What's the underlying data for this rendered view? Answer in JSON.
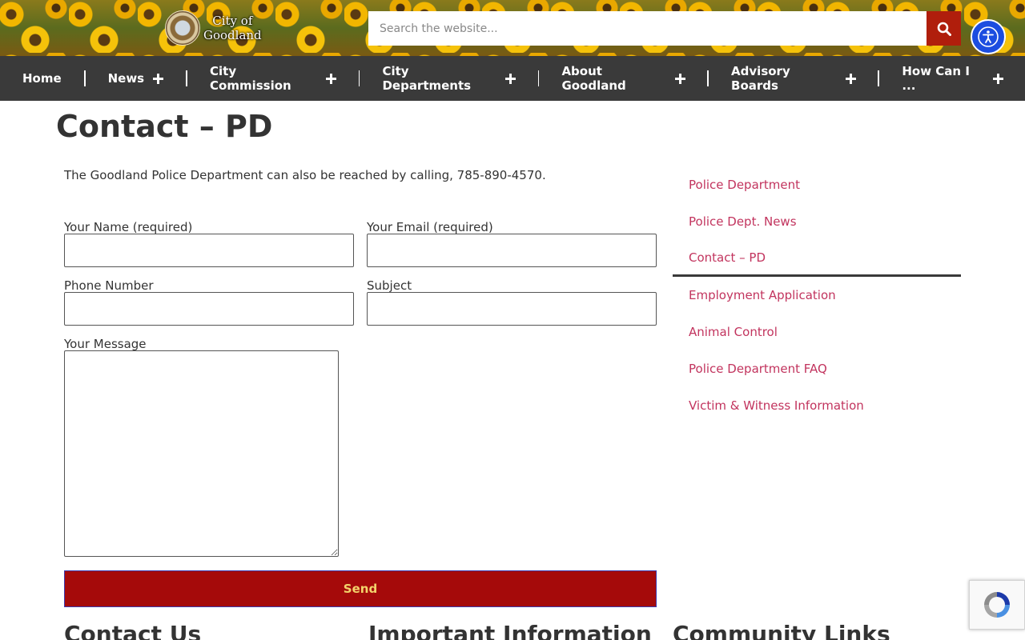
{
  "header": {
    "logo_line1": "City of",
    "logo_line2": "Goodland",
    "search_placeholder": "Search the website...",
    "search_icon": "search-icon",
    "accessibility_icon": "accessibility-icon"
  },
  "nav": {
    "items": [
      {
        "label": "Home",
        "has_submenu": false
      },
      {
        "label": "News",
        "has_submenu": true
      },
      {
        "label": "City Commission",
        "has_submenu": true
      },
      {
        "label": "City Departments",
        "has_submenu": true
      },
      {
        "label": "About Goodland",
        "has_submenu": true
      },
      {
        "label": "Advisory Boards",
        "has_submenu": true
      },
      {
        "label": "How Can I ...",
        "has_submenu": true
      }
    ]
  },
  "page": {
    "title": "Contact – PD",
    "intro": "The Goodland Police Department can also be reached by calling, 785-890-4570."
  },
  "form": {
    "name_label": "Your Name (required)",
    "email_label": "Your Email (required)",
    "phone_label": "Phone Number",
    "subject_label": "Subject",
    "message_label": "Your Message",
    "send_label": "Send"
  },
  "sidebar": {
    "items": [
      {
        "label": "Police Department",
        "active": false
      },
      {
        "label": "Police Dept. News",
        "active": false
      },
      {
        "label": "Contact – PD",
        "active": true
      },
      {
        "label": "Employment Application",
        "active": false
      },
      {
        "label": "Animal Control",
        "active": false
      },
      {
        "label": "Police Department FAQ",
        "active": false
      },
      {
        "label": "Victim & Witness Information",
        "active": false
      }
    ]
  },
  "footer": {
    "col1": "Contact Us",
    "col2": "Important Information",
    "col3": "Community Links"
  },
  "colors": {
    "nav_bg": "#3a3a3a",
    "search_button": "#b01e0c",
    "accessibility_button": "#1c4de0",
    "send_button": "#a50a0a",
    "send_text": "#f3d36b",
    "sidebar_link": "#c2345e"
  }
}
